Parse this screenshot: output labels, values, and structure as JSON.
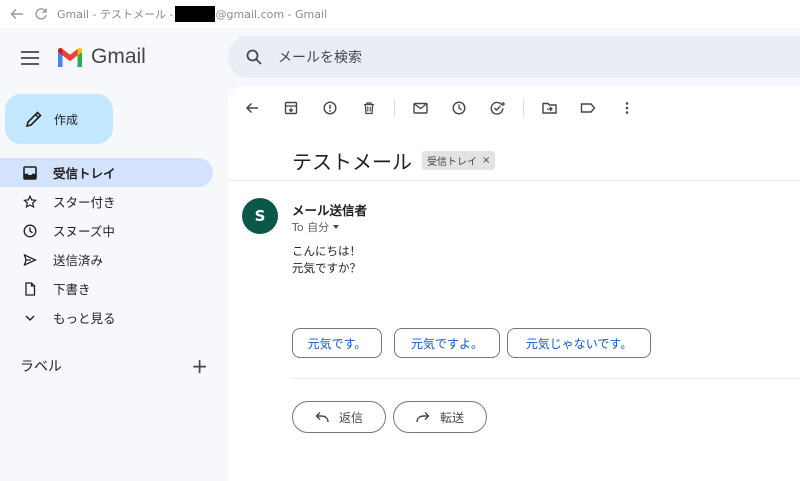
{
  "browser": {
    "title_prefix": "Gmail - テストメール - ",
    "title_suffix": "@gmail.com - Gmail"
  },
  "app": {
    "name": "Gmail"
  },
  "compose": {
    "label": "作成"
  },
  "nav": [
    {
      "label": "受信トレイ",
      "icon": "inbox-icon",
      "active": true
    },
    {
      "label": "スター付き",
      "icon": "star-icon"
    },
    {
      "label": "スヌーズ中",
      "icon": "clock-icon"
    },
    {
      "label": "送信済み",
      "icon": "send-icon"
    },
    {
      "label": "下書き",
      "icon": "file-icon"
    },
    {
      "label": "もっと見る",
      "icon": "chevron-down-icon"
    }
  ],
  "labels": {
    "title": "ラベル",
    "add_icon": "plus-icon"
  },
  "search": {
    "placeholder": "メールを検索"
  },
  "message": {
    "subject": "テストメール",
    "label_chip": "受信トレイ",
    "avatar_letter": "S",
    "sender": "メール送信者",
    "to": "To 自分",
    "body_lines": [
      "こんにちは！",
      "元気ですか？"
    ]
  },
  "smart_replies": [
    "元気です。",
    "元気ですよ。",
    "元気じゃないです。"
  ],
  "actions": {
    "reply": "返信",
    "forward": "転送"
  },
  "colors": {
    "accent": "#c2e7ff",
    "active_nav": "#d3e3fd",
    "avatar": "#0b5748",
    "link": "#0b57d0"
  }
}
